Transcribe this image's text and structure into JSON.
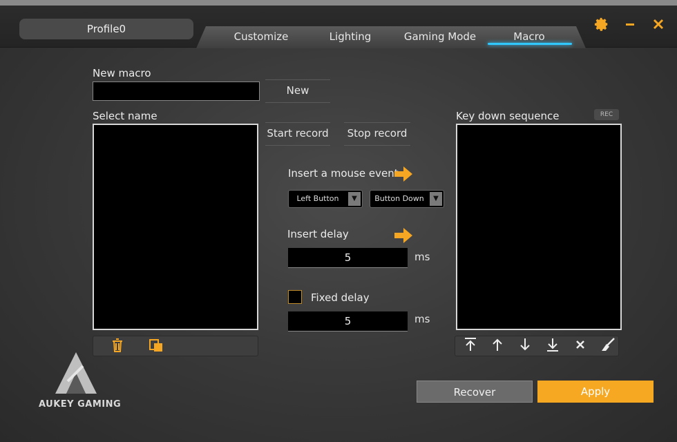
{
  "header": {
    "profile_name": "Profile0",
    "tabs": [
      {
        "label": "Customize"
      },
      {
        "label": "Lighting"
      },
      {
        "label": "Gaming Mode"
      },
      {
        "label": "Macro",
        "active": true
      }
    ],
    "accent_color": "#f5a623",
    "active_tab_color": "#30c8ff",
    "icons": [
      "gear-icon",
      "minimize-icon",
      "close-icon"
    ]
  },
  "new_macro": {
    "label": "New macro",
    "input_value": "",
    "new_button": "New"
  },
  "select_name": {
    "label": "Select name",
    "items": [],
    "toolbar_icons": [
      "trash-icon",
      "copy-icon"
    ]
  },
  "record": {
    "start_label": "Start record",
    "stop_label": "Stop record"
  },
  "mouse_event": {
    "label": "Insert a mouse event",
    "button_select": "Left Button",
    "action_select": "Button Down"
  },
  "delay": {
    "label": "Insert delay",
    "value": "5",
    "unit": "ms"
  },
  "fixed_delay": {
    "label": "Fixed delay",
    "checked": false,
    "value": "5",
    "unit": "ms"
  },
  "key_sequence": {
    "label": "Key down sequence",
    "rec_badge": "REC",
    "items": [],
    "toolbar_icons": [
      "move-top-icon",
      "move-up-icon",
      "move-down-icon",
      "move-bottom-icon",
      "delete-icon",
      "clear-icon"
    ]
  },
  "footer": {
    "recover_label": "Recover",
    "apply_label": "Apply",
    "brand": "AUKEY GAMING"
  }
}
